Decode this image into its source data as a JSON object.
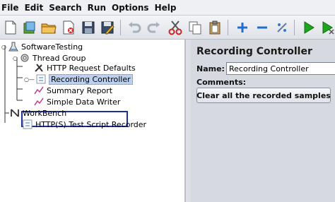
{
  "menubar": {
    "items": [
      "File",
      "Edit",
      "Search",
      "Run",
      "Options",
      "Help"
    ]
  },
  "toolbar": {
    "buttons": [
      "new-icon",
      "templates-icon",
      "open-icon",
      "close-icon",
      "save-icon",
      "save-as-icon",
      "undo-icon",
      "redo-icon",
      "cut-icon",
      "copy-icon",
      "paste-icon",
      "expand-icon",
      "collapse-icon",
      "toggle-icon",
      "start-icon",
      "start-no-pauses-icon"
    ]
  },
  "tree": {
    "nodes": [
      {
        "label": "SoftwareTesting",
        "icon": "test-plan-icon"
      },
      {
        "label": "Thread Group",
        "icon": "thread-group-icon"
      },
      {
        "label": "HTTP Request Defaults",
        "icon": "config-element-icon"
      },
      {
        "label": "Recording Controller",
        "icon": "controller-icon",
        "selected": true
      },
      {
        "label": "Summary Report",
        "icon": "listener-icon"
      },
      {
        "label": "Simple Data Writer",
        "icon": "listener-icon"
      },
      {
        "label": "WorkBench",
        "icon": "workbench-icon"
      },
      {
        "label": "HTTP(S) Test Script Recorder",
        "icon": "controller-icon"
      }
    ]
  },
  "panel": {
    "title": "Recording Controller",
    "name_label": "Name:",
    "name_value": "Recording Controller",
    "comments_label": "Comments:",
    "clear_button": "Clear all the recorded samples"
  },
  "colors": {
    "selection": "#bcd0ee",
    "highlight_box": "#1c2e9c",
    "run_green": "#1ea51e",
    "add_blue": "#1f6fd0"
  }
}
